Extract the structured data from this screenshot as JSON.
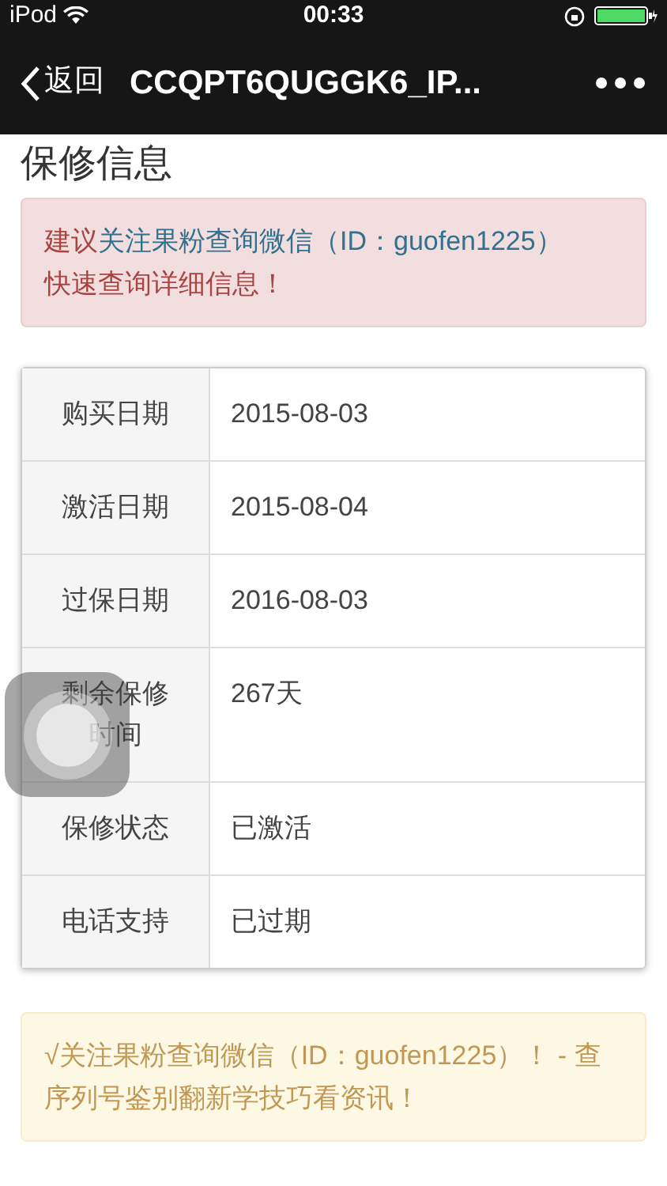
{
  "status_bar": {
    "device": "iPod",
    "time": "00:33"
  },
  "nav": {
    "back": "返回",
    "title": "CCQPT6QUGGK6_IP..."
  },
  "heading": "保修信息",
  "alert": {
    "prefix": "建议",
    "link": "关注果粉查询微信（ID：guofen1225）",
    "suffix": "快速查询详细信息！"
  },
  "table": {
    "rows": [
      {
        "label": "购买日期",
        "value": "2015-08-03"
      },
      {
        "label": "激活日期",
        "value": "2015-08-04"
      },
      {
        "label": "过保日期",
        "value": "2016-08-03"
      },
      {
        "label": "剩余保修时间",
        "value": "267天"
      },
      {
        "label": "保修状态",
        "value": "已激活"
      },
      {
        "label": "电话支持",
        "value": "已过期"
      }
    ]
  },
  "notice": "√关注果粉查询微信（ID：guofen1225）！ - 查序列号鉴别翻新学技巧看资讯！"
}
